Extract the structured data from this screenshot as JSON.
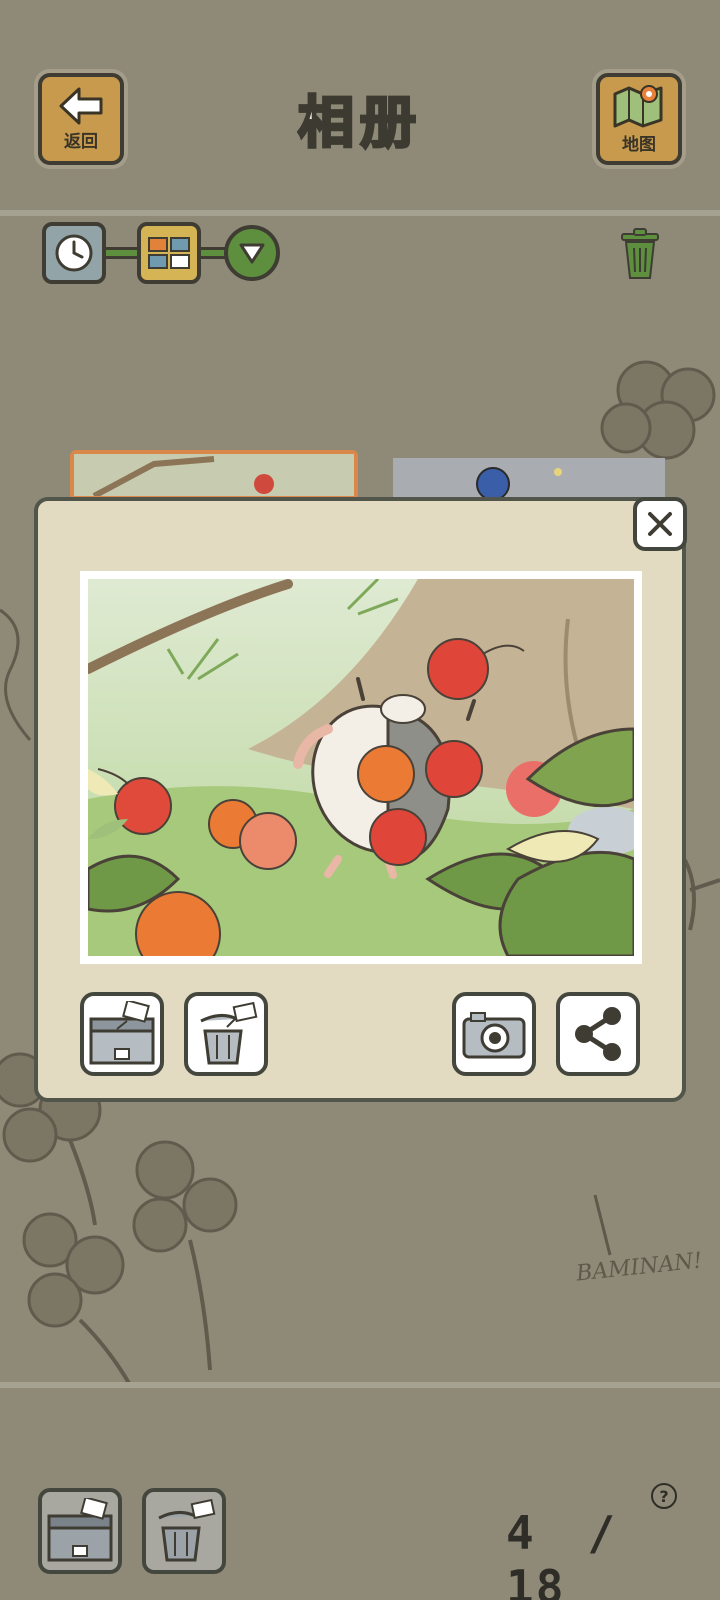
{
  "header": {
    "title": "相册",
    "back_label": "返回",
    "map_label": "地图"
  },
  "toolbar": {
    "view_options": [
      "clock-icon",
      "grid-icon",
      "dropdown-icon"
    ],
    "trash_icon": "trash-icon"
  },
  "album": {
    "counter_current": "4",
    "counter_separator": "/",
    "counter_total": "18",
    "help_label": "?"
  },
  "modal": {
    "close_label": "×",
    "photo_description_icon": "photo-hedgehog-cherries",
    "actions_left": [
      "save-to-box-icon",
      "discard-to-trash-icon"
    ],
    "actions_right": [
      "camera-icon",
      "share-icon"
    ]
  },
  "decor": {
    "signature_text": "BAMINAN!"
  },
  "colors": {
    "background": "#8f8a78",
    "modal_bg": "#e3dbc1",
    "wood": "#c79a4e",
    "green": "#5d8f3f",
    "title_fill": "#f2efe6"
  }
}
